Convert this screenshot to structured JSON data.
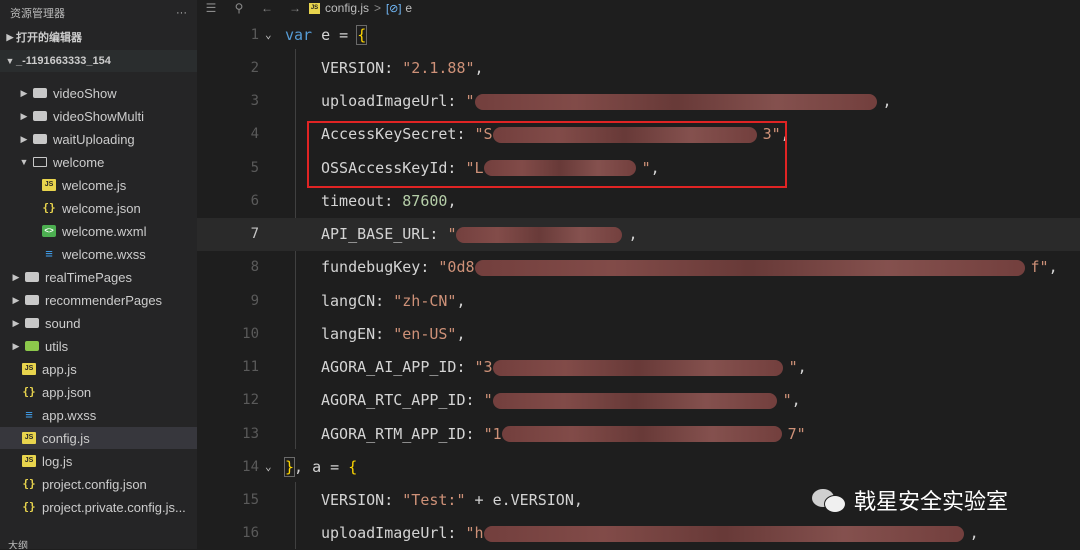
{
  "sidebar": {
    "title": "资源管理器",
    "more": "···",
    "open_editors": "打开的编辑器",
    "project": "_-1191663333_154",
    "items": [
      {
        "label": "videoShow",
        "icon": "folder-icon",
        "kind": "folder"
      },
      {
        "label": "videoShowMulti",
        "icon": "folder-icon",
        "kind": "folder"
      },
      {
        "label": "waitUploading",
        "icon": "folder-icon",
        "kind": "folder"
      },
      {
        "label": "welcome",
        "icon": "folder-open-icon",
        "kind": "folder-open"
      },
      {
        "label": "welcome.js",
        "icon": "js-file-icon",
        "kind": "js"
      },
      {
        "label": "welcome.json",
        "icon": "json-file-icon",
        "kind": "json"
      },
      {
        "label": "welcome.wxml",
        "icon": "wxml-file-icon",
        "kind": "wxml"
      },
      {
        "label": "welcome.wxss",
        "icon": "wxss-file-icon",
        "kind": "wxss"
      },
      {
        "label": "realTimePages",
        "icon": "folder-icon",
        "kind": "folder"
      },
      {
        "label": "recommenderPages",
        "icon": "folder-icon",
        "kind": "folder"
      },
      {
        "label": "sound",
        "icon": "folder-icon",
        "kind": "folder"
      },
      {
        "label": "utils",
        "icon": "folder-green-icon",
        "kind": "folder-green"
      },
      {
        "label": "app.js",
        "icon": "js-file-icon",
        "kind": "js"
      },
      {
        "label": "app.json",
        "icon": "json-file-icon",
        "kind": "json"
      },
      {
        "label": "app.wxss",
        "icon": "wxss-file-icon",
        "kind": "wxss"
      },
      {
        "label": "config.js",
        "icon": "js-file-icon",
        "kind": "js"
      },
      {
        "label": "log.js",
        "icon": "js-file-icon",
        "kind": "js"
      },
      {
        "label": "project.config.json",
        "icon": "json-file-icon",
        "kind": "json"
      },
      {
        "label": "project.private.config.js...",
        "icon": "json-file-icon",
        "kind": "json"
      }
    ],
    "bottom_section": "大纲"
  },
  "breadcrumb": {
    "file": "config.js",
    "separator": ">",
    "symbol_icon": "[⊘]",
    "symbol": "e"
  },
  "editor": {
    "lines": [
      {
        "n": "1",
        "key": "var",
        "text": " e = ",
        "brace": "{"
      },
      {
        "n": "2",
        "key": "VERSION: ",
        "value": "\"2.1.88\"",
        "tail": ","
      },
      {
        "n": "3",
        "key": "uploadImageUrl: ",
        "value": "\"",
        "tail": ","
      },
      {
        "n": "4",
        "key": "AccessKeySecret: ",
        "value": "\"S",
        "value_end": "3\"",
        "tail": ","
      },
      {
        "n": "5",
        "key": "OSSAccessKeyId: ",
        "value": "\"L",
        "value_end": "\"",
        "tail": ","
      },
      {
        "n": "6",
        "key": "timeout: ",
        "value": "87600",
        "tail": ","
      },
      {
        "n": "7",
        "key": "API_BASE_URL: ",
        "value": "\"",
        "tail": ","
      },
      {
        "n": "8",
        "key": "fundebugKey: ",
        "value": "\"0d8",
        "value_end": "f\"",
        "tail": ","
      },
      {
        "n": "9",
        "key": "langCN: ",
        "value": "\"zh-CN\"",
        "tail": ","
      },
      {
        "n": "10",
        "key": "langEN: ",
        "value": "\"en-US\"",
        "tail": ","
      },
      {
        "n": "11",
        "key": "AGORA_AI_APP_ID: ",
        "value": "\"3",
        "value_end": "\"",
        "tail": ","
      },
      {
        "n": "12",
        "key": "AGORA_RTC_APP_ID: ",
        "value": "\"",
        "value_end": "\"",
        "tail": ","
      },
      {
        "n": "13",
        "key": "AGORA_RTM_APP_ID: ",
        "value": "\"1",
        "value_end": "7\"",
        "tail": ""
      },
      {
        "n": "14",
        "brace_close": "}",
        "text": ", a = ",
        "brace": "{"
      },
      {
        "n": "15",
        "key": "VERSION: ",
        "value": "\"Test:\"",
        "tail": " + e.VERSION,"
      },
      {
        "n": "16",
        "key": "uploadImageUrl: ",
        "value": "\"h",
        "tail": ","
      }
    ],
    "current_line": "7"
  },
  "watermark": {
    "text": "戟星安全实验室"
  },
  "colors": {
    "keyword": "#569cd6",
    "string": "#ce9178",
    "number": "#b5cea8",
    "highlight_box": "#e02424"
  }
}
